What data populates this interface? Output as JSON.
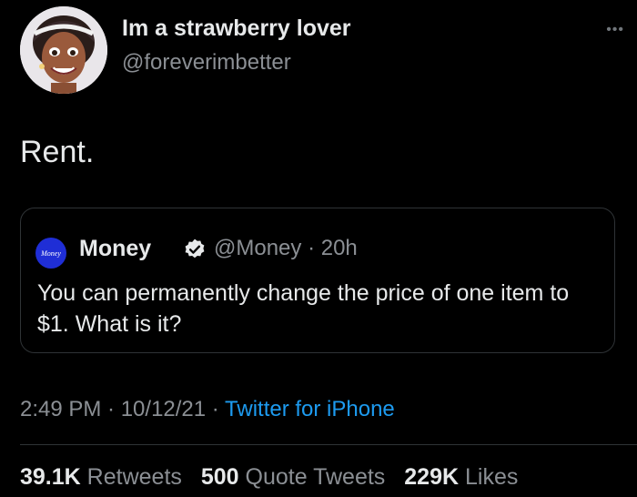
{
  "author": {
    "display_name": "Im a strawberry lover",
    "handle": "@foreverimbetter",
    "avatar_icon": "cartoon-woman-avatar"
  },
  "more_icon": "more-options-icon",
  "tweet_text": "Rent.",
  "quoted_tweet": {
    "avatar_label": "Money",
    "avatar_color": "#1f2ed6",
    "name": "Money",
    "verified_icon": "verified-badge-icon",
    "meta": "@Money · 20h",
    "text": "You can permanently change the price of one item to $1. What is it?"
  },
  "timestamp": {
    "time_date": "2:49 PM · 10/12/21 · ",
    "source": "Twitter for iPhone"
  },
  "stats": {
    "retweets_count": "39.1K",
    "retweets_label": "Retweets",
    "quotes_count": "500",
    "quotes_label": "Quote Tweets",
    "likes_count": "229K",
    "likes_label": "Likes"
  },
  "colors": {
    "background": "#000000",
    "text": "#e7e9ea",
    "secondary": "#8b8f94",
    "link": "#1d9bf0",
    "border": "#2f3336"
  }
}
